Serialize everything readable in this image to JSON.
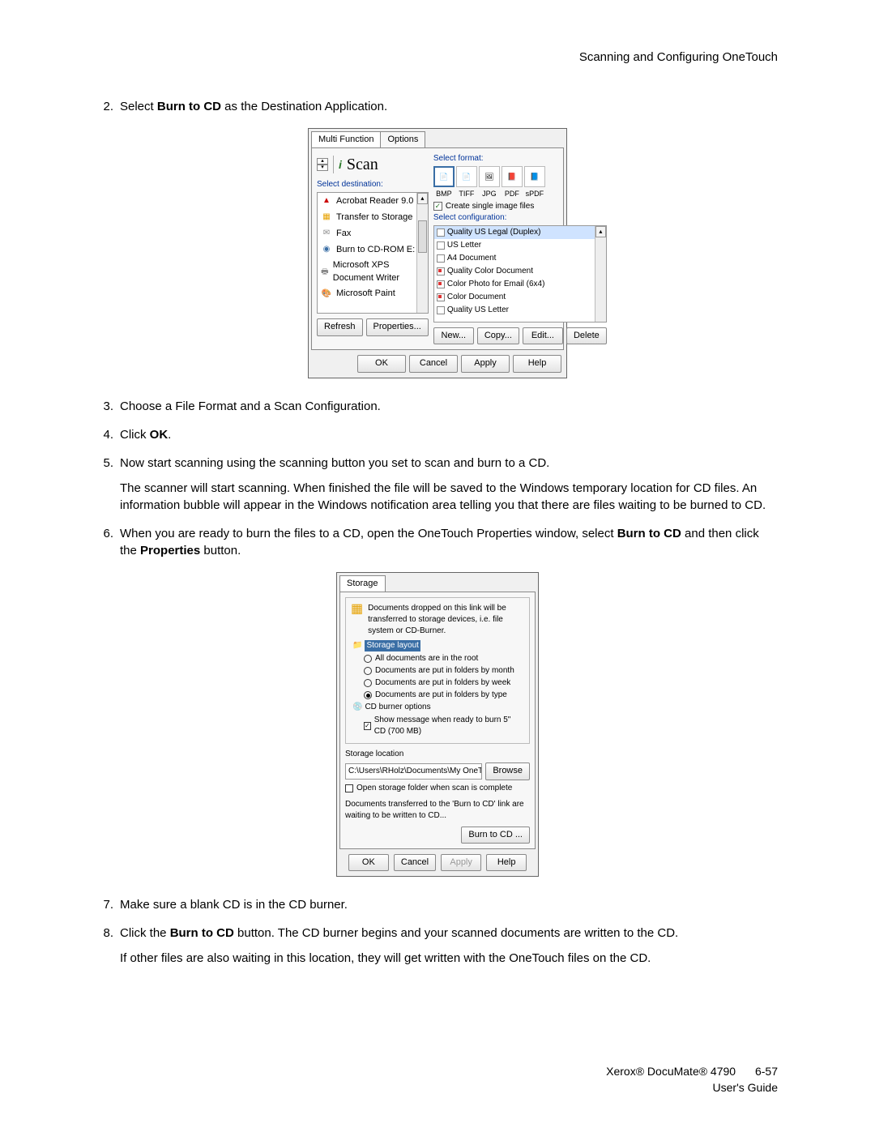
{
  "header": {
    "title": "Scanning and Configuring OneTouch"
  },
  "steps": {
    "s2": {
      "num": "2.",
      "text_a": "Select ",
      "bold": "Burn to CD",
      "text_b": " as the Destination Application."
    },
    "s3": {
      "num": "3.",
      "text": "Choose a File Format and a Scan Configuration."
    },
    "s4": {
      "num": "4.",
      "text_a": "Click ",
      "bold": "OK",
      "text_b": "."
    },
    "s5": {
      "num": "5.",
      "text": "Now start scanning using the scanning button you set to scan and burn to a CD.",
      "para": "The scanner will start scanning. When finished the file will be saved to the Windows temporary location for CD files. An information bubble will appear in the Windows notification area telling you that there are files waiting to be burned to CD."
    },
    "s6": {
      "num": "6.",
      "text_a": "When you are ready to burn the files to a CD, open the OneTouch Properties window, select ",
      "bold1": "Burn to CD",
      "text_b": " and then click the ",
      "bold2": "Properties",
      "text_c": " button."
    },
    "s7": {
      "num": "7.",
      "text": "Make sure a blank CD is in the CD burner."
    },
    "s8": {
      "num": "8.",
      "text_a": "Click the ",
      "bold": "Burn to CD",
      "text_b": " button. The CD burner begins and your scanned documents are written to the CD.",
      "para": "If other files are also waiting in this location, they will get written with the OneTouch files on the CD."
    }
  },
  "dlg1": {
    "tabs": [
      "Multi Function",
      "Options"
    ],
    "scan_word": "Scan",
    "select_dest": "Select destination:",
    "dest": [
      "Acrobat Reader 9.0",
      "Transfer to Storage",
      "Fax",
      "Burn to CD-ROM E:",
      "Microsoft XPS Document Writer",
      "Microsoft Paint"
    ],
    "select_format": "Select format:",
    "formats": [
      "BMP",
      "TIFF",
      "JPG",
      "PDF",
      "sPDF"
    ],
    "create_single": "Create single image files",
    "select_config": "Select configuration:",
    "configs": [
      "Quality US Legal (Duplex)",
      "US Letter",
      "A4 Document",
      "Quality Color Document",
      "Color Photo for Email (6x4)",
      "Color Document",
      "Quality US Letter"
    ],
    "btns1": {
      "refresh": "Refresh",
      "properties": "Properties...",
      "new": "New...",
      "copy": "Copy...",
      "edit": "Edit...",
      "delete": "Delete"
    },
    "btns2": {
      "ok": "OK",
      "cancel": "Cancel",
      "apply": "Apply",
      "help": "Help"
    }
  },
  "dlg2": {
    "tab": "Storage",
    "desc": "Documents dropped on this link will be transferred to storage devices, i.e. file system or CD-Burner.",
    "storage_layout": "Storage layout",
    "radios": [
      "All documents are in the root",
      "Documents are put in folders by month",
      "Documents are put in folders by week",
      "Documents are put in folders by type"
    ],
    "cd_options": "CD burner options",
    "show_msg": "Show message when ready to burn 5\" CD (700 MB)",
    "storage_location": "Storage location",
    "path": "C:\\Users\\RHolz\\Documents\\My OneTouch Archiv",
    "browse": "Browse",
    "open_folder": "Open storage folder when scan is complete",
    "waiting": "Documents transferred to the 'Burn to CD' link are waiting to be written to CD...",
    "burn": "Burn to CD ...",
    "btns": {
      "ok": "OK",
      "cancel": "Cancel",
      "apply": "Apply",
      "help": "Help"
    }
  },
  "footer": {
    "product": "Xerox® DocuMate® 4790",
    "page": "6-57",
    "guide": "User's Guide"
  }
}
